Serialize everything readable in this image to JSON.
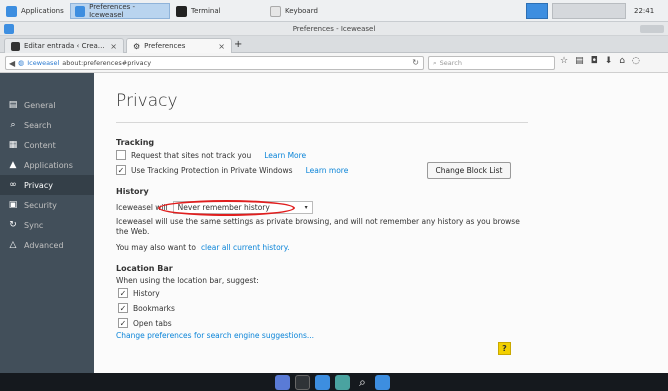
{
  "colors": {
    "sidebar_bg": "#424f5a",
    "sidebar_active_bg": "#343f48",
    "link": "#0a84d8",
    "annotation_red": "#e01e1e",
    "help_yellow": "#f2d000"
  },
  "system_panel": {
    "items": [
      {
        "label": "Applications",
        "icon": "apps-menu-icon"
      },
      {
        "label": "Preferences - Iceweasel",
        "icon": "iceweasel-icon"
      },
      {
        "label": "Terminal",
        "icon": "terminal-icon"
      },
      {
        "label": "Keyboard",
        "icon": "keyboard-icon"
      }
    ],
    "clock": "22:41"
  },
  "window": {
    "title": "Preferences - Iceweasel"
  },
  "tabs": [
    {
      "label": "Editar entrada ‹ Crea…",
      "close": "×",
      "active": false
    },
    {
      "label": "Preferences",
      "close": "×",
      "active": true
    }
  ],
  "new_tab_label": "+",
  "urlbar": {
    "identity": "Iceweasel",
    "path": "about:preferences#privacy",
    "reload": "↻"
  },
  "searchbar": {
    "placeholder": "Search"
  },
  "sidebar": {
    "items": [
      {
        "label": "General",
        "icon": "general-icon",
        "glyph": "▤"
      },
      {
        "label": "Search",
        "icon": "search-icon",
        "glyph": "⌕"
      },
      {
        "label": "Content",
        "icon": "content-icon",
        "glyph": "▦"
      },
      {
        "label": "Applications",
        "icon": "applications-icon",
        "glyph": "▲"
      },
      {
        "label": "Privacy",
        "icon": "privacy-mask-icon",
        "glyph": "∞"
      },
      {
        "label": "Security",
        "icon": "security-lock-icon",
        "glyph": "▣"
      },
      {
        "label": "Sync",
        "icon": "sync-icon",
        "glyph": "↻"
      },
      {
        "label": "Advanced",
        "icon": "advanced-icon",
        "glyph": "△"
      }
    ],
    "active_index": 4
  },
  "main": {
    "title": "Privacy",
    "tracking": {
      "heading": "Tracking",
      "dnt_label": "Request that sites not track you",
      "dnt_checked": false,
      "dnt_link": "Learn More",
      "tp_label": "Use Tracking Protection in Private Windows",
      "tp_checked": true,
      "tp_link": "Learn more",
      "block_list_button": "Change Block List"
    },
    "history": {
      "heading": "History",
      "prefix": "Iceweasel will",
      "dropdown_value": "Never remember history",
      "description": "Iceweasel will use the same settings as private browsing, and will not remember any history as you browse the Web.",
      "clear_prefix": "You may also want to",
      "clear_link": "clear all current history."
    },
    "location_bar": {
      "heading": "Location Bar",
      "subheading": "When using the location bar, suggest:",
      "options": [
        {
          "label": "History",
          "checked": true
        },
        {
          "label": "Bookmarks",
          "checked": true
        },
        {
          "label": "Open tabs",
          "checked": true
        }
      ],
      "search_link": "Change preferences for search engine suggestions..."
    },
    "help_label": "?"
  },
  "dock": {
    "items": [
      {
        "icon": "workspace-icon",
        "color": "#5a7bd6"
      },
      {
        "icon": "terminal-icon",
        "color": "#2f3337"
      },
      {
        "icon": "files-icon",
        "color": "#3d8ee0"
      },
      {
        "icon": "browser-icon",
        "color": "#4aa3a0"
      },
      {
        "icon": "search-icon",
        "color": "#ffffff"
      },
      {
        "icon": "folder-icon",
        "color": "#3d8ee0"
      }
    ]
  }
}
